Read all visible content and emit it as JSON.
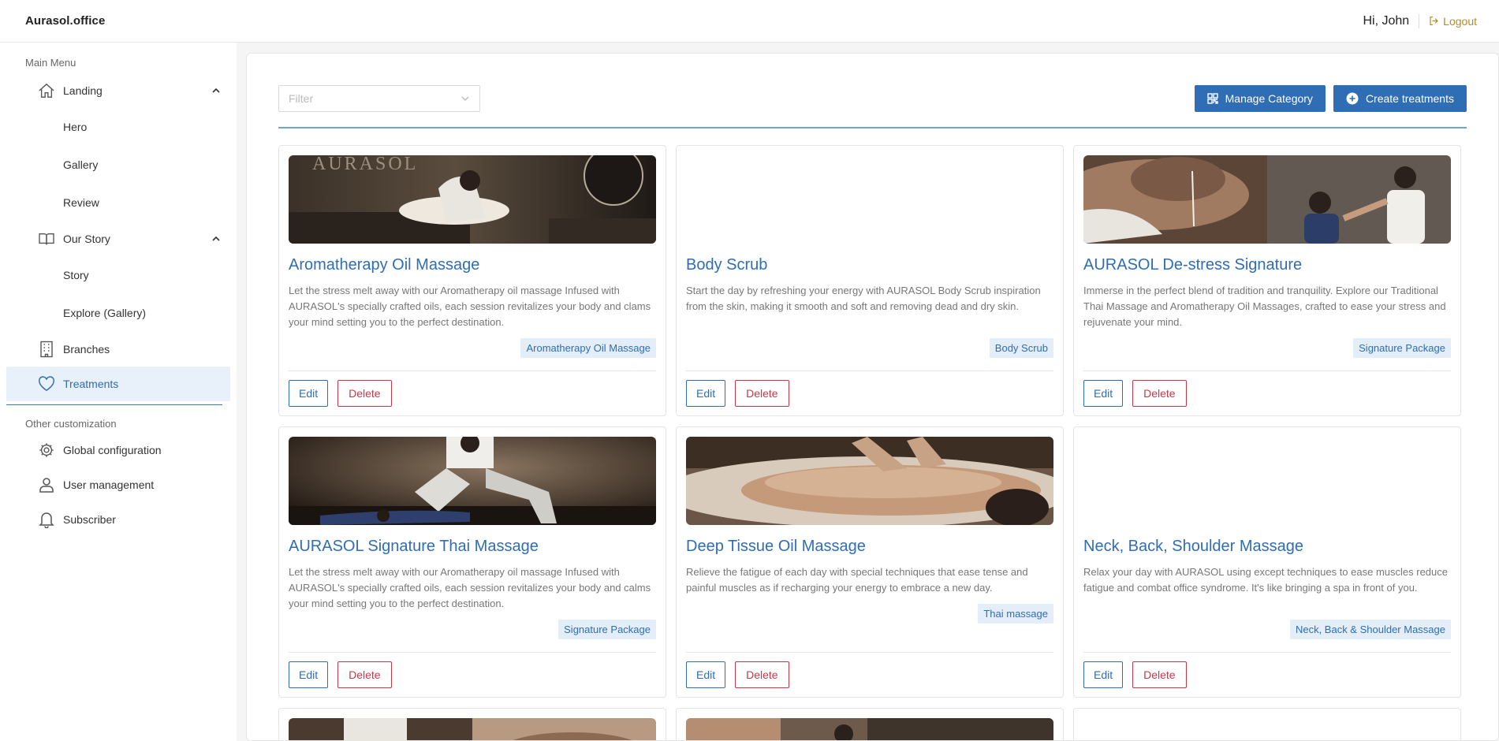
{
  "header": {
    "brand": "Aurasol.office",
    "greeting": "Hi, John",
    "logout_label": "Logout"
  },
  "sidebar": {
    "main_menu_label": "Main Menu",
    "landing_label": "Landing",
    "landing_sub": [
      "Hero",
      "Gallery",
      "Review"
    ],
    "our_story_label": "Our Story",
    "our_story_sub": [
      "Story",
      "Explore (Gallery)"
    ],
    "branches_label": "Branches",
    "treatments_label": "Treatments",
    "other_label": "Other customization",
    "global_config_label": "Global configuration",
    "user_mgmt_label": "User management",
    "subscriber_label": "Subscriber"
  },
  "toolbar": {
    "filter_placeholder": "Filter",
    "manage_category_label": "Manage Category",
    "create_treatments_label": "Create treatments"
  },
  "card_actions": {
    "edit_label": "Edit",
    "delete_label": "Delete"
  },
  "cards": [
    {
      "title": "Aromatherapy Oil Massage",
      "description": "Let the stress melt away with our Aromatherapy oil massage Infused with AURASOL's specially crafted oils, each session revitalizes your body and clams your mind setting you to the perfect destination.",
      "category": "Aromatherapy Oil Massage",
      "image_text": "AURASOL"
    },
    {
      "title": "Body Scrub",
      "description": "Start the day by refreshing your energy with AURASOL Body Scrub inspiration from the skin, making it smooth and soft and removing dead and dry skin.",
      "category": "Body Scrub"
    },
    {
      "title": "AURASOL De-stress Signature",
      "description": "Immerse in the perfect blend of tradition and tranquility. Explore our Traditional Thai Massage and Aromatherapy Oil Massages, crafted to ease your stress and rejuvenate your mind.",
      "category": "Signature Package"
    },
    {
      "title": "AURASOL Signature Thai Massage",
      "description": "Let the stress melt away with our Aromatherapy oil massage Infused with AURASOL's specially crafted oils, each session revitalizes your body and calms your mind setting you to the perfect destination.",
      "category": "Signature Package"
    },
    {
      "title": "Deep Tissue Oil Massage",
      "description": "Relieve the fatigue of each day with special techniques that ease tense and painful muscles as if recharging your energy to embrace a new day.",
      "category": "Thai massage"
    },
    {
      "title": "Neck, Back, Shoulder Massage",
      "description": "Relax your day with AURASOL using except techniques to ease muscles reduce fatigue and combat office syndrome. It's like bringing a spa in front of you.",
      "category": "Neck, Back & Shoulder Massage"
    }
  ]
}
